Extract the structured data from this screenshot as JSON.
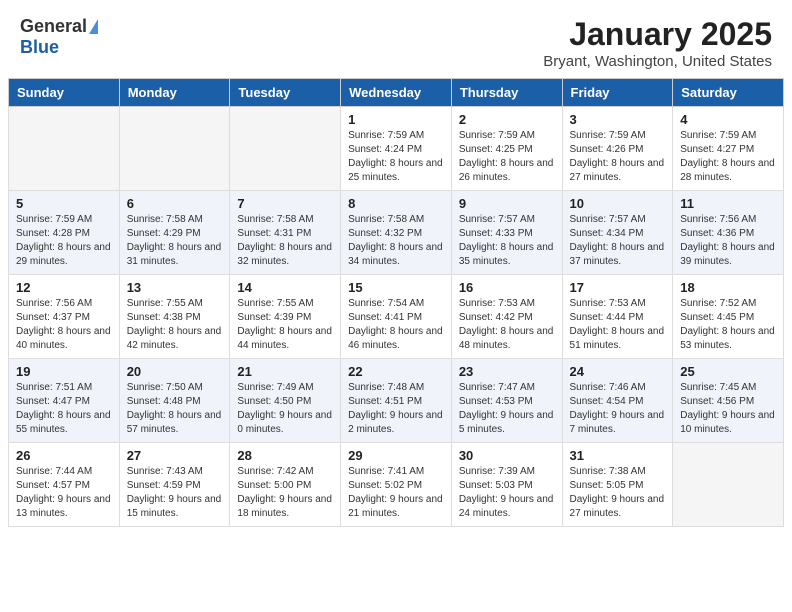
{
  "header": {
    "logo_general": "General",
    "logo_blue": "Blue",
    "month_title": "January 2025",
    "location": "Bryant, Washington, United States"
  },
  "days_of_week": [
    "Sunday",
    "Monday",
    "Tuesday",
    "Wednesday",
    "Thursday",
    "Friday",
    "Saturday"
  ],
  "weeks": [
    [
      {
        "empty": true
      },
      {
        "empty": true
      },
      {
        "empty": true
      },
      {
        "day": "1",
        "sunrise": "7:59 AM",
        "sunset": "4:24 PM",
        "daylight": "8 hours and 25 minutes."
      },
      {
        "day": "2",
        "sunrise": "7:59 AM",
        "sunset": "4:25 PM",
        "daylight": "8 hours and 26 minutes."
      },
      {
        "day": "3",
        "sunrise": "7:59 AM",
        "sunset": "4:26 PM",
        "daylight": "8 hours and 27 minutes."
      },
      {
        "day": "4",
        "sunrise": "7:59 AM",
        "sunset": "4:27 PM",
        "daylight": "8 hours and 28 minutes."
      }
    ],
    [
      {
        "day": "5",
        "sunrise": "7:59 AM",
        "sunset": "4:28 PM",
        "daylight": "8 hours and 29 minutes."
      },
      {
        "day": "6",
        "sunrise": "7:58 AM",
        "sunset": "4:29 PM",
        "daylight": "8 hours and 31 minutes."
      },
      {
        "day": "7",
        "sunrise": "7:58 AM",
        "sunset": "4:31 PM",
        "daylight": "8 hours and 32 minutes."
      },
      {
        "day": "8",
        "sunrise": "7:58 AM",
        "sunset": "4:32 PM",
        "daylight": "8 hours and 34 minutes."
      },
      {
        "day": "9",
        "sunrise": "7:57 AM",
        "sunset": "4:33 PM",
        "daylight": "8 hours and 35 minutes."
      },
      {
        "day": "10",
        "sunrise": "7:57 AM",
        "sunset": "4:34 PM",
        "daylight": "8 hours and 37 minutes."
      },
      {
        "day": "11",
        "sunrise": "7:56 AM",
        "sunset": "4:36 PM",
        "daylight": "8 hours and 39 minutes."
      }
    ],
    [
      {
        "day": "12",
        "sunrise": "7:56 AM",
        "sunset": "4:37 PM",
        "daylight": "8 hours and 40 minutes."
      },
      {
        "day": "13",
        "sunrise": "7:55 AM",
        "sunset": "4:38 PM",
        "daylight": "8 hours and 42 minutes."
      },
      {
        "day": "14",
        "sunrise": "7:55 AM",
        "sunset": "4:39 PM",
        "daylight": "8 hours and 44 minutes."
      },
      {
        "day": "15",
        "sunrise": "7:54 AM",
        "sunset": "4:41 PM",
        "daylight": "8 hours and 46 minutes."
      },
      {
        "day": "16",
        "sunrise": "7:53 AM",
        "sunset": "4:42 PM",
        "daylight": "8 hours and 48 minutes."
      },
      {
        "day": "17",
        "sunrise": "7:53 AM",
        "sunset": "4:44 PM",
        "daylight": "8 hours and 51 minutes."
      },
      {
        "day": "18",
        "sunrise": "7:52 AM",
        "sunset": "4:45 PM",
        "daylight": "8 hours and 53 minutes."
      }
    ],
    [
      {
        "day": "19",
        "sunrise": "7:51 AM",
        "sunset": "4:47 PM",
        "daylight": "8 hours and 55 minutes."
      },
      {
        "day": "20",
        "sunrise": "7:50 AM",
        "sunset": "4:48 PM",
        "daylight": "8 hours and 57 minutes."
      },
      {
        "day": "21",
        "sunrise": "7:49 AM",
        "sunset": "4:50 PM",
        "daylight": "9 hours and 0 minutes."
      },
      {
        "day": "22",
        "sunrise": "7:48 AM",
        "sunset": "4:51 PM",
        "daylight": "9 hours and 2 minutes."
      },
      {
        "day": "23",
        "sunrise": "7:47 AM",
        "sunset": "4:53 PM",
        "daylight": "9 hours and 5 minutes."
      },
      {
        "day": "24",
        "sunrise": "7:46 AM",
        "sunset": "4:54 PM",
        "daylight": "9 hours and 7 minutes."
      },
      {
        "day": "25",
        "sunrise": "7:45 AM",
        "sunset": "4:56 PM",
        "daylight": "9 hours and 10 minutes."
      }
    ],
    [
      {
        "day": "26",
        "sunrise": "7:44 AM",
        "sunset": "4:57 PM",
        "daylight": "9 hours and 13 minutes."
      },
      {
        "day": "27",
        "sunrise": "7:43 AM",
        "sunset": "4:59 PM",
        "daylight": "9 hours and 15 minutes."
      },
      {
        "day": "28",
        "sunrise": "7:42 AM",
        "sunset": "5:00 PM",
        "daylight": "9 hours and 18 minutes."
      },
      {
        "day": "29",
        "sunrise": "7:41 AM",
        "sunset": "5:02 PM",
        "daylight": "9 hours and 21 minutes."
      },
      {
        "day": "30",
        "sunrise": "7:39 AM",
        "sunset": "5:03 PM",
        "daylight": "9 hours and 24 minutes."
      },
      {
        "day": "31",
        "sunrise": "7:38 AM",
        "sunset": "5:05 PM",
        "daylight": "9 hours and 27 minutes."
      },
      {
        "empty": true
      }
    ]
  ]
}
